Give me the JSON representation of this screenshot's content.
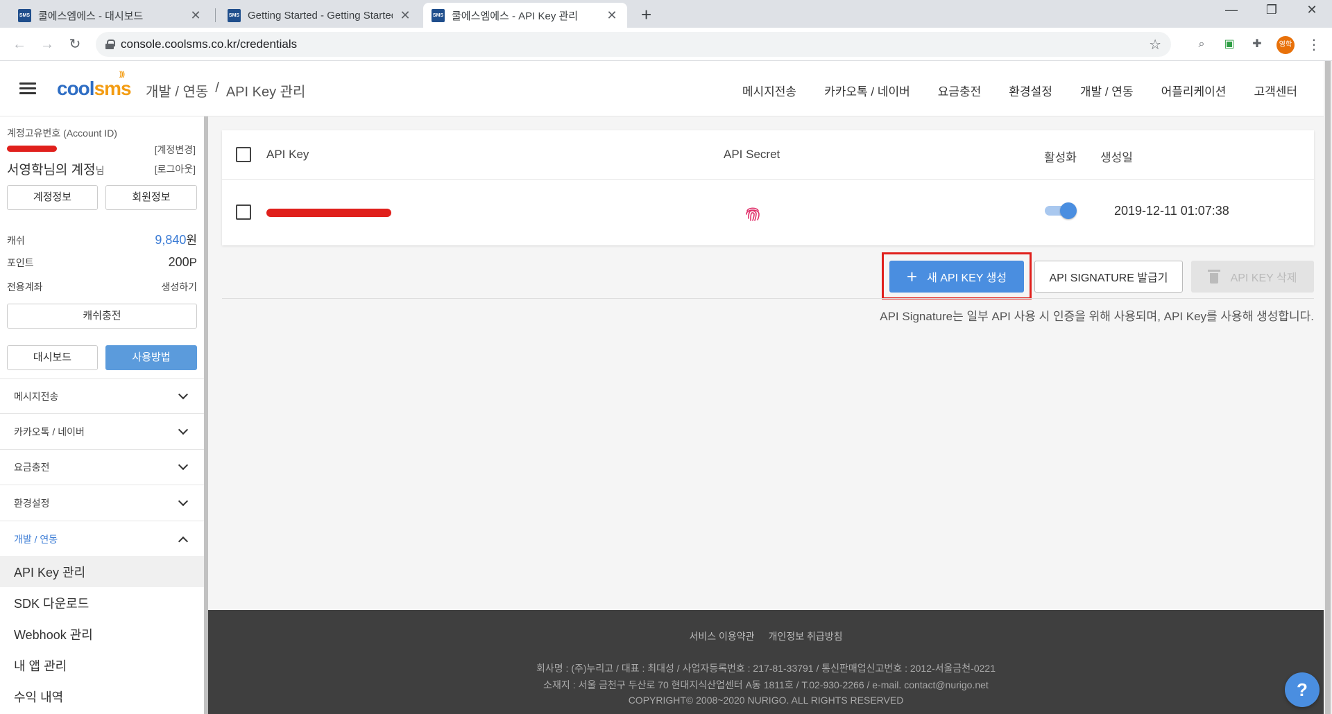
{
  "browser": {
    "tabs": [
      {
        "favicon": "SMS",
        "label": "쿨에스엠에스 - 대시보드",
        "active": false
      },
      {
        "favicon": "SMS",
        "label": "Getting Started - Getting Started",
        "active": false
      },
      {
        "favicon": "SMS",
        "label": "쿨에스엠에스 - API Key 관리",
        "active": true
      }
    ],
    "url": "console.coolsms.co.kr/credentials",
    "profile_initials": "영학"
  },
  "header": {
    "logo": {
      "part1": "cool",
      "part2": "sms"
    },
    "breadcrumb": [
      "개발 / 연동",
      "/",
      "API Key 관리"
    ],
    "nav": [
      "메시지전송",
      "카카오톡 / 네이버",
      "요금충전",
      "환경설정",
      "개발 / 연동",
      "어플리케이션",
      "고객센터"
    ]
  },
  "sidebar": {
    "account_id_label": "계정고유번호 (Account ID)",
    "account_change": "[계정변경]",
    "account_name": "서영학님의 계정",
    "account_name_suffix": "님",
    "logout": "[로그아웃]",
    "btn_account_info": "계정정보",
    "btn_member_info": "회원정보",
    "cash_label": "캐쉬",
    "cash_value": "9,840",
    "cash_unit": "원",
    "point_label": "포인트",
    "point_value": "200",
    "point_unit": "P",
    "account_label": "전용계좌",
    "account_action": "생성하기",
    "btn_charge": "캐쉬충전",
    "btn_dashboard": "대시보드",
    "btn_usage": "사용방법",
    "menu": [
      {
        "label": "메시지전송",
        "open": false
      },
      {
        "label": "카카오톡 / 네이버",
        "open": false
      },
      {
        "label": "요금충전",
        "open": false
      },
      {
        "label": "환경설정",
        "open": false
      },
      {
        "label": "개발 / 연동",
        "open": true
      }
    ],
    "submenu": [
      "API Key 관리",
      "SDK 다운로드",
      "Webhook 관리",
      "내 앱 관리",
      "수익 내역"
    ]
  },
  "table": {
    "headers": {
      "api_key": "API Key",
      "api_secret": "API Secret",
      "active": "활성화",
      "created": "생성일"
    },
    "rows": [
      {
        "api_key": "[redacted]",
        "active": true,
        "created": "2019-12-11 01:07:38"
      }
    ]
  },
  "actions": {
    "new_key": "새 API KEY 생성",
    "signature": "API SIGNATURE 발급기",
    "delete_key": "API KEY 삭제"
  },
  "note": "API Signature는 일부 API 사용 시 인증을 위해 사용되며, API Key를 사용해 생성합니다.",
  "footer": {
    "links": [
      "서비스 이용약관",
      "개인정보 취급방침"
    ],
    "company": "회사명 : (주)누리고 / 대표 : 최대성 / 사업자등록번호 : 217-81-33791 / 통신판매업신고번호 : 2012-서울금천-0221",
    "address": "소재지 : 서울 금천구 두산로 70 현대지식산업센터 A동 1811호 / T.02-930-2266 / e-mail. contact@nurigo.net",
    "copyright": "COPYRIGHT© 2008~2020 NURIGO. ALL RIGHTS RESERVED"
  },
  "colors": {
    "accent": "#4a8ee0",
    "highlight": "#e0201c",
    "footer_bg": "#3f3f3f"
  }
}
